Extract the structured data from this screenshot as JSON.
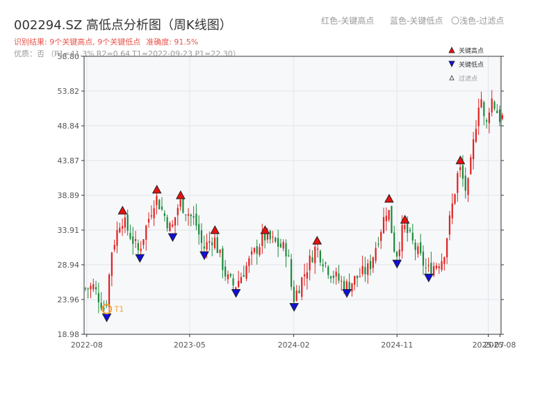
{
  "header": {
    "title": "002294.SZ 高低点分析图（周K线图）",
    "legend_red": "红色-关键高点",
    "legend_blue": "蓝色-关键低点",
    "legend_light": "〇浅色-过滤点",
    "result_label": "识别结果: 9个关键高点, 9个关键低点",
    "accuracy_label": "准确度: 91.5%",
    "quality_line": [
      "优质：否",
      "（P1=41.3%",
      "R2=0.64",
      "T1=2022-09-23 P1=22.30）"
    ]
  },
  "chart_data": {
    "type": "candlestick",
    "ylim": [
      18.98,
      58.8
    ],
    "yticks": [
      "18.98",
      "23.96",
      "28.94",
      "33.91",
      "38.89",
      "43.87",
      "48.84",
      "53.82",
      "58.80"
    ],
    "xlim": [
      "2022-07-25",
      "2025-08-04"
    ],
    "xticks": [
      {
        "date": "2022-08-01",
        "label": "2022-08"
      },
      {
        "date": "2023-05-01",
        "label": "2023-05"
      },
      {
        "date": "2024-02-01",
        "label": "2024-02"
      },
      {
        "date": "2024-11-01",
        "label": "2024-11"
      },
      {
        "date": "2025-07-01",
        "label": "2025-07"
      },
      {
        "date": "2025-08-01",
        "label": "2025-08"
      }
    ],
    "price_path": [
      [
        "2022-07-25",
        25.5
      ],
      [
        "2022-08-22",
        25.8
      ],
      [
        "2022-09-23",
        22.3
      ],
      [
        "2022-10-10",
        31.0
      ],
      [
        "2022-11-04",
        35.8
      ],
      [
        "2022-12-20",
        30.8
      ],
      [
        "2023-02-03",
        38.8
      ],
      [
        "2023-03-17",
        33.8
      ],
      [
        "2023-04-07",
        38.0
      ],
      [
        "2023-05-20",
        35.0
      ],
      [
        "2023-06-09",
        31.2
      ],
      [
        "2023-07-07",
        33.0
      ],
      [
        "2023-08-11",
        27.0
      ],
      [
        "2023-09-01",
        25.8
      ],
      [
        "2023-11-17",
        33.0
      ],
      [
        "2024-01-19",
        31.0
      ],
      [
        "2024-02-02",
        23.8
      ],
      [
        "2024-04-03",
        31.5
      ],
      [
        "2024-05-10",
        28.0
      ],
      [
        "2024-06-21",
        25.8
      ],
      [
        "2024-08-23",
        28.5
      ],
      [
        "2024-10-11",
        37.5
      ],
      [
        "2024-11-01",
        30.0
      ],
      [
        "2024-11-22",
        34.5
      ],
      [
        "2025-01-24",
        28.0
      ],
      [
        "2025-03-07",
        30.0
      ],
      [
        "2025-04-18",
        43.0
      ],
      [
        "2025-05-09",
        39.0
      ],
      [
        "2025-06-13",
        54.0
      ],
      [
        "2025-06-27",
        48.0
      ],
      [
        "2025-07-11",
        53.0
      ],
      [
        "2025-08-04",
        50.0
      ]
    ],
    "key_highs": [
      {
        "date": "2022-11-04",
        "price": 35.8
      },
      {
        "date": "2023-02-03",
        "price": 38.8
      },
      {
        "date": "2023-04-07",
        "price": 38.0
      },
      {
        "date": "2023-07-07",
        "price": 33.0
      },
      {
        "date": "2023-11-17",
        "price": 33.0
      },
      {
        "date": "2024-04-03",
        "price": 31.5
      },
      {
        "date": "2024-10-11",
        "price": 37.5
      },
      {
        "date": "2024-11-22",
        "price": 34.5
      },
      {
        "date": "2025-04-18",
        "price": 43.0
      }
    ],
    "key_lows": [
      {
        "date": "2022-09-23",
        "price": 22.3
      },
      {
        "date": "2022-12-20",
        "price": 30.8
      },
      {
        "date": "2023-03-17",
        "price": 33.8
      },
      {
        "date": "2023-06-09",
        "price": 31.2
      },
      {
        "date": "2023-09-01",
        "price": 25.8
      },
      {
        "date": "2024-02-02",
        "price": 23.8
      },
      {
        "date": "2024-06-21",
        "price": 25.8
      },
      {
        "date": "2024-11-01",
        "price": 30.0
      },
      {
        "date": "2025-01-24",
        "price": 28.0
      }
    ],
    "t1_marker": {
      "date": "2022-09-23",
      "price": 22.3,
      "label": "T1"
    },
    "legend": {
      "high": "关键高点",
      "low": "关键低点",
      "filtered": "过滤点",
      "position": "top-right"
    },
    "colors": {
      "up": "#e02020",
      "down": "#1a8a3a",
      "high_marker": "#e81010",
      "low_marker": "#1010d8",
      "t1": "#f0a030",
      "grid": "#e2e5ea",
      "plot_bg": "#f7f8fa"
    },
    "grid": true
  }
}
